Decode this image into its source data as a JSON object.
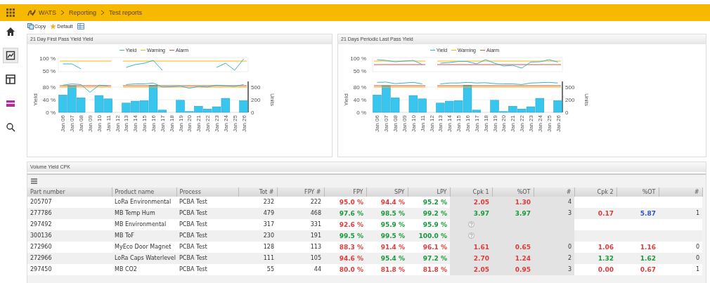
{
  "header": {
    "breadcrumb": [
      {
        "label": "WATS"
      },
      {
        "label": "Reporting"
      },
      {
        "label": "Test reports"
      }
    ]
  },
  "sidebar": {
    "items": [
      {
        "kind": "home",
        "selected": false
      },
      {
        "kind": "chart",
        "selected": true
      },
      {
        "kind": "dashboard",
        "selected": false
      },
      {
        "kind": "report",
        "selected": false
      },
      {
        "kind": "search",
        "selected": false
      }
    ]
  },
  "toolbar": {
    "buttons": [
      {
        "kind": "copy",
        "label": "Copy"
      },
      {
        "kind": "default",
        "label": "Default"
      },
      {
        "kind": "table"
      }
    ]
  },
  "charts": [
    {
      "title": "21 Day First Pass Yield Yield",
      "legend": [
        {
          "label": "Yield",
          "color": "#35b6c9"
        },
        {
          "label": "Warning",
          "color": "#f5b800"
        },
        {
          "label": "Alarm",
          "color": "#e0504a"
        }
      ],
      "top_ticks": [
        "100 %",
        "50 %"
      ],
      "left_ticks": [
        "80 %",
        "40 %",
        "0 %"
      ],
      "right_ticks": [
        "500",
        "200",
        "0"
      ],
      "ylabel": "Yield",
      "right_label": "Units",
      "x_labels": [
        "Jan 06",
        "Jan 07",
        "Jan 08",
        "Jan 09",
        "Jan 10",
        "Jan 11",
        "Jan 12",
        "Jan 13",
        "Jan 14",
        "Jan 15",
        "Jan 16",
        "Jan 17",
        "Jan 18",
        "Jan 19",
        "Jan 20",
        "Jan 21",
        "Jan 22",
        "Jan 23",
        "Jan 24",
        "Jan 25",
        "Jan 26"
      ]
    },
    {
      "title": "21 Days Periodic Last Pass Yield",
      "legend": [
        {
          "label": "Yield",
          "color": "#35b6c9"
        },
        {
          "label": "Warning",
          "color": "#f5b800"
        },
        {
          "label": "Alarm",
          "color": "#e0504a"
        }
      ],
      "top_ticks": [
        "100 %",
        "50 %"
      ],
      "left_ticks": [
        "80 %",
        "40 %",
        "0 %"
      ],
      "right_ticks": [
        "500",
        "200",
        "0"
      ],
      "ylabel": "Yield",
      "right_label": "Units",
      "x_labels": [
        "Jan 06",
        "Jan 07",
        "Jan 08",
        "Jan 09",
        "Jan 10",
        "Jan 11",
        "Jan 12",
        "Jan 13",
        "Jan 14",
        "Jan 15",
        "Jan 16",
        "Jan 17",
        "Jan 18",
        "Jan 19",
        "Jan 20",
        "Jan 21",
        "Jan 22",
        "Jan 23",
        "Jan 24",
        "Jan 25",
        "Jan 26"
      ]
    }
  ],
  "table": {
    "title": "Volume Yield CPK",
    "columns": [
      "Part number",
      "Product name",
      "Process",
      "Tot #",
      "FPY #",
      "FPY",
      "SPY",
      "LPY",
      "Cpk 1",
      "%OT",
      "#",
      "Cpk 2",
      "%OT",
      "#"
    ],
    "rows": [
      {
        "cells": [
          {
            "text": "205707"
          },
          {
            "text": "LoRa Environmental"
          },
          {
            "text": "PCBA Test"
          },
          {
            "text": "232"
          },
          {
            "text": "222"
          },
          {
            "text": "95.0 %",
            "color": "#e03b3b"
          },
          {
            "text": "94.4 %",
            "color": "#e03b3b"
          },
          {
            "text": "95.2 %",
            "color": "#1a9a3a"
          },
          {
            "text": "2.05",
            "color": "#e03b3b"
          },
          {
            "text": "1.30",
            "color": "#e03b3b"
          },
          {
            "text": "4"
          },
          {},
          {},
          {}
        ]
      },
      {
        "cells": [
          {
            "text": "277786"
          },
          {
            "text": "MB Temp Hum"
          },
          {
            "text": "PCBA Test"
          },
          {
            "text": "479"
          },
          {
            "text": "468"
          },
          {
            "text": "97.6 %",
            "color": "#1a9a3a"
          },
          {
            "text": "98.5 %",
            "color": "#1a9a3a"
          },
          {
            "text": "99.2 %",
            "color": "#1a9a3a"
          },
          {
            "text": "3.97",
            "color": "#1a9a3a"
          },
          {
            "text": "3.97",
            "color": "#1a9a3a"
          },
          {
            "text": "3"
          },
          {
            "text": "0.17",
            "color": "#e03b3b"
          },
          {
            "text": "5.87",
            "color": "#3050d0"
          },
          {
            "text": "1"
          }
        ]
      },
      {
        "cells": [
          {
            "text": "297492"
          },
          {
            "text": "MB Environmental"
          },
          {
            "text": "PCBA Test"
          },
          {
            "text": "317"
          },
          {
            "text": "331"
          },
          {
            "text": "92.6 %",
            "color": "#e03b3b"
          },
          {
            "text": "95.9 %",
            "color": "#1a9a3a"
          },
          {
            "text": "95.9 %",
            "color": "#1a9a3a"
          },
          {
            "kind": "help"
          },
          {},
          {},
          {},
          {},
          {}
        ]
      },
      {
        "cells": [
          {
            "text": "300136"
          },
          {
            "text": "MB ToF"
          },
          {
            "text": "PCBA Test"
          },
          {
            "text": "230"
          },
          {
            "text": "191"
          },
          {
            "text": "99.5 %",
            "color": "#1a9a3a"
          },
          {
            "text": "99.5 %",
            "color": "#1a9a3a"
          },
          {
            "text": "100.0 %",
            "color": "#1a9a3a"
          },
          {
            "kind": "help"
          },
          {},
          {},
          {},
          {},
          {}
        ]
      },
      {
        "cells": [
          {
            "text": "272960"
          },
          {
            "text": "MyEco Door Magnet"
          },
          {
            "text": "PCBA Test"
          },
          {
            "text": "128"
          },
          {
            "text": "113"
          },
          {
            "text": "88.3 %",
            "color": "#e03b3b"
          },
          {
            "text": "91.4 %",
            "color": "#e03b3b"
          },
          {
            "text": "96.1 %",
            "color": "#e03b3b"
          },
          {
            "text": "1.61",
            "color": "#e03b3b"
          },
          {
            "text": "0.65",
            "color": "#e03b3b"
          },
          {
            "text": "0"
          },
          {
            "text": "1.06",
            "color": "#e03b3b"
          },
          {
            "text": "1.16",
            "color": "#e03b3b"
          },
          {
            "text": "0"
          }
        ]
      },
      {
        "cells": [
          {
            "text": "272966"
          },
          {
            "text": "LoRa Caps Waterlevel"
          },
          {
            "text": "PCBA Test"
          },
          {
            "text": "111"
          },
          {
            "text": "105"
          },
          {
            "text": "94.6 %",
            "color": "#e03b3b"
          },
          {
            "text": "95.4 %",
            "color": "#1a9a3a"
          },
          {
            "text": "97.2 %",
            "color": "#1a9a3a"
          },
          {
            "text": "2.70",
            "color": "#e03b3b"
          },
          {
            "text": "1.24",
            "color": "#e03b3b"
          },
          {
            "text": "2"
          },
          {
            "text": "1.32",
            "color": "#1a9a3a"
          },
          {
            "text": "1.62",
            "color": "#1a9a3a"
          },
          {
            "text": "0"
          }
        ]
      },
      {
        "cells": [
          {
            "text": "297450"
          },
          {
            "text": "MB CO2"
          },
          {
            "text": "PCBA Test"
          },
          {
            "text": "55"
          },
          {
            "text": "44"
          },
          {
            "text": "80.0 %",
            "color": "#e03b3b"
          },
          {
            "text": "81.8 %",
            "color": "#e03b3b"
          },
          {
            "text": "81.8 %",
            "color": "#e03b3b"
          },
          {
            "text": "2.05",
            "color": "#e03b3b"
          },
          {
            "text": "0.95",
            "color": "#e03b3b"
          },
          {
            "text": "3"
          },
          {
            "text": "0.00",
            "color": "#e03b3b"
          },
          {
            "text": "0.67",
            "color": "#e03b3b"
          },
          {
            "text": "1"
          }
        ]
      }
    ]
  }
}
